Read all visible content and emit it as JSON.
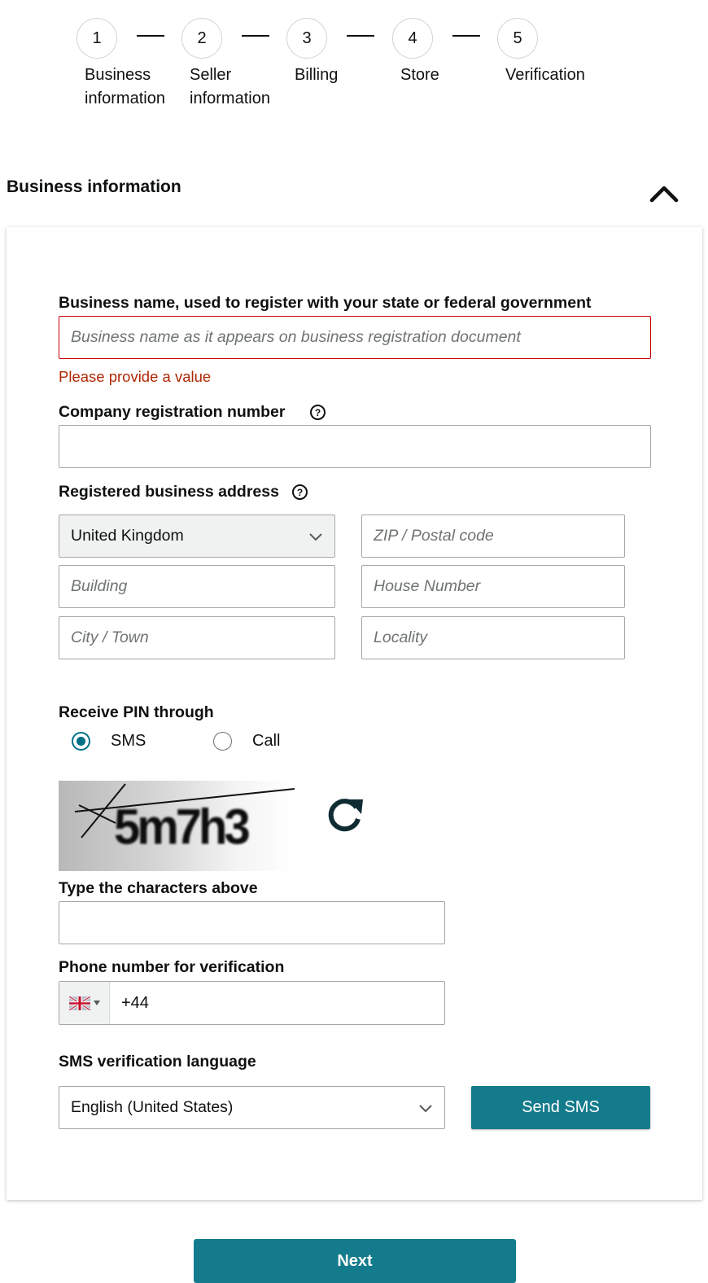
{
  "stepper": {
    "steps": [
      {
        "number": "1",
        "label_line1": "Business",
        "label_line2": "information"
      },
      {
        "number": "2",
        "label_line1": "Seller",
        "label_line2": "information"
      },
      {
        "number": "3",
        "label_line1": "Billing",
        "label_line2": ""
      },
      {
        "number": "4",
        "label_line1": "Store",
        "label_line2": ""
      },
      {
        "number": "5",
        "label_line1": "Verification",
        "label_line2": ""
      }
    ]
  },
  "section": {
    "title": "Business information",
    "collapse_icon": "chevron-up-icon"
  },
  "form": {
    "business_name": {
      "label": "Business name, used to register with your state or federal government",
      "placeholder": "Business name as it appears on business registration document",
      "value": "",
      "error": "Please provide a value"
    },
    "company_reg": {
      "label": "Company registration number",
      "help_icon": "question-circle-icon",
      "value": ""
    },
    "address": {
      "label": "Registered business address",
      "help_icon": "question-circle-icon",
      "country": "United Kingdom",
      "zip_placeholder": "ZIP / Postal code",
      "building_placeholder": "Building",
      "house_placeholder": "House Number",
      "city_placeholder": "City / Town",
      "locality_placeholder": "Locality"
    },
    "pin": {
      "label": "Receive PIN through",
      "options": [
        {
          "label": "SMS",
          "selected": true
        },
        {
          "label": "Call",
          "selected": false
        }
      ]
    },
    "captcha": {
      "image_text": "5m7h3",
      "refresh_icon": "refresh-icon",
      "input_label": "Type the characters above",
      "value": ""
    },
    "phone": {
      "label": "Phone number for verification",
      "country_flag": "uk-flag-icon",
      "value": "+44"
    },
    "sms_language": {
      "label": "SMS verification language",
      "selected": "English (United States)"
    },
    "send_sms_label": "Send SMS"
  },
  "footer": {
    "next_label": "Next"
  },
  "colors": {
    "accent": "#137b8c",
    "radio_selected": "#007185",
    "error": "#c40000"
  }
}
